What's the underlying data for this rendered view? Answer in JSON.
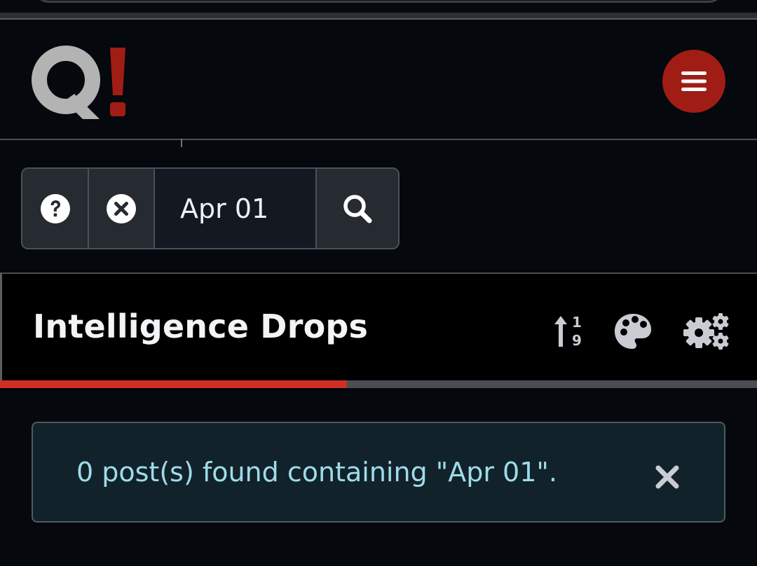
{
  "logo": {
    "text": "Q!",
    "q_color": "#b3b3b3",
    "mark_color": "#a01d16"
  },
  "header": {
    "menu_icon": "hamburger-icon",
    "menu_color": "#a01d16"
  },
  "search": {
    "value": "Apr 01",
    "help_icon": "question-circle-icon",
    "clear_icon": "times-circle-icon",
    "search_icon": "search-icon"
  },
  "section": {
    "title": "Intelligence Drops",
    "sort_icon": "sort-numeric-up-icon",
    "palette_icon": "palette-icon",
    "settings_icon": "cogs-icon",
    "progress_fraction": 0.457,
    "progress_color": "#cf2f24"
  },
  "alert": {
    "message": "0 post(s) found containing \"Apr 01\".",
    "close_icon": "close-icon",
    "text_color": "#9fdcea"
  }
}
